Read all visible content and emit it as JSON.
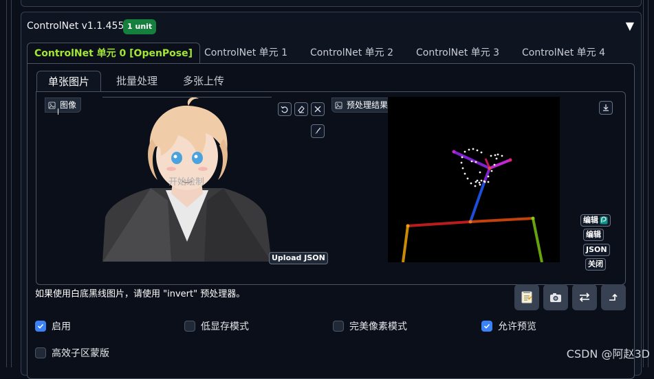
{
  "panel": {
    "title": "ControlNet v1.1.455",
    "badge": "1 unit",
    "collapse_icon": "triangle-down-icon"
  },
  "unit_tabs": [
    {
      "label": "ControlNet 单元 0 [OpenPose]",
      "active": true
    },
    {
      "label": "ControlNet 单元 1",
      "active": false
    },
    {
      "label": "ControlNet 单元 2",
      "active": false
    },
    {
      "label": "ControlNet 单元 3",
      "active": false
    },
    {
      "label": "ControlNet 单元 4",
      "active": false
    }
  ],
  "sub_tabs": [
    {
      "label": "单张图片",
      "active": true
    },
    {
      "label": "批量处理",
      "active": false
    },
    {
      "label": "多张上传",
      "active": false
    }
  ],
  "image_panel": {
    "label": "图像",
    "overlay_text": "开始绘制",
    "upload_json": "Upload JSON",
    "tools": [
      "undo-icon",
      "eraser-icon",
      "close-icon",
      "brush-icon"
    ]
  },
  "preview_panel": {
    "label": "预处理结果预览",
    "download_icon": "download-icon",
    "buttons": {
      "edit_icon_label": "编辑",
      "edit_label": "编辑",
      "json_label": "JSON",
      "close_label": "关闭"
    }
  },
  "hint": "如果使用白底黑线图片，请使用 \"invert\" 预处理器。",
  "action_icons": [
    "notepad-icon",
    "camera-icon",
    "swap-icon",
    "send-upload-icon"
  ],
  "options": [
    {
      "label": "启用",
      "checked": true
    },
    {
      "label": "低显存模式",
      "checked": false
    },
    {
      "label": "完美像素模式",
      "checked": false
    },
    {
      "label": "允许预览",
      "checked": true
    },
    {
      "label": "高效子区蒙版",
      "checked": false
    }
  ],
  "watermark": "CSDN @阿赵3D",
  "colors": {
    "accent_green": "#a3e635",
    "badge_green": "#15803d",
    "checkbox_blue": "#3b82f6",
    "background": "#0b0f19"
  }
}
